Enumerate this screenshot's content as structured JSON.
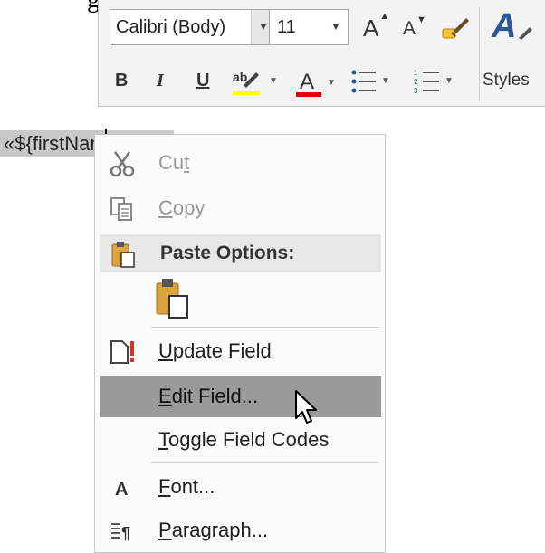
{
  "heading_fragment": "g",
  "toolbar": {
    "font_name": "Calibri (Body)",
    "font_size": "11",
    "grow_font": "A",
    "shrink_font": "A",
    "bold": "B",
    "italic": "I",
    "underline": "U",
    "font_color_letter": "A",
    "styles_icon": "A",
    "styles_label": "Styles",
    "highlight_color": "#ffff00",
    "font_color": "#e00000"
  },
  "document": {
    "field_text": "«${firstName}»"
  },
  "context_menu": {
    "items": [
      {
        "label": "Cut",
        "underline_index": 2,
        "icon": "scissors-icon",
        "enabled": false
      },
      {
        "label": "Copy",
        "underline_index": 0,
        "icon": "copy-icon",
        "enabled": false
      },
      {
        "label": "Paste Options:",
        "icon": "clipboard-icon"
      },
      {
        "label": "Update Field",
        "underline_index": 0,
        "icon": "update-field-icon",
        "enabled": true
      },
      {
        "label": "Edit Field...",
        "underline_index": 0,
        "icon": "",
        "enabled": true,
        "highlighted": true
      },
      {
        "label": "Toggle Field Codes",
        "underline_index": 0,
        "icon": "",
        "enabled": true
      },
      {
        "label": "Font...",
        "underline_index": 0,
        "icon": "font-icon",
        "enabled": true
      },
      {
        "label": "Paragraph...",
        "underline_index": 0,
        "icon": "paragraph-icon",
        "enabled": true
      }
    ],
    "highlight_color": "#9a9a9a"
  }
}
